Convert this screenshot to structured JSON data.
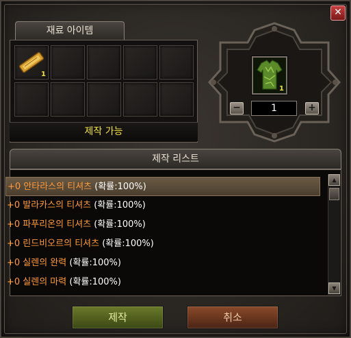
{
  "window": {
    "close_label": "✕"
  },
  "materials": {
    "tab_label": "재료 아이템",
    "slots": [
      {
        "icon": "gold-scroll-icon",
        "count": "1"
      },
      {
        "icon": "",
        "count": ""
      },
      {
        "icon": "",
        "count": ""
      },
      {
        "icon": "",
        "count": ""
      },
      {
        "icon": "",
        "count": ""
      },
      {
        "icon": "",
        "count": ""
      },
      {
        "icon": "",
        "count": ""
      },
      {
        "icon": "",
        "count": ""
      },
      {
        "icon": "",
        "count": ""
      },
      {
        "icon": "",
        "count": ""
      }
    ],
    "status_text": "제작 가능"
  },
  "result": {
    "icon": "green-shirt-icon",
    "count": "1",
    "quantity": "1",
    "minus_label": "−",
    "plus_label": "+"
  },
  "craft_list": {
    "title": "제작 리스트",
    "items": [
      {
        "name": "+0 안타라스의 티셔츠 ",
        "prob": "(확률:100%)",
        "selected": true
      },
      {
        "name": "+0 발라카스의 티셔츠 ",
        "prob": "(확률:100%)",
        "selected": false
      },
      {
        "name": "+0 파푸리온의 티셔츠 ",
        "prob": "(확률:100%)",
        "selected": false
      },
      {
        "name": "+0 린드비오르의 티셔츠 ",
        "prob": "(확률:100%)",
        "selected": false
      },
      {
        "name": "+0 실렌의 완력 ",
        "prob": "(확률:100%)",
        "selected": false
      },
      {
        "name": "+0 실렌의 마력 ",
        "prob": "(확률:100%)",
        "selected": false
      }
    ],
    "scroll_up": "▲",
    "scroll_down": "▼"
  },
  "buttons": {
    "craft_label": "제작",
    "cancel_label": "취소"
  },
  "colors": {
    "item_text": "#ff9a3a",
    "prob_text": "#ffffff",
    "status_text": "#f0e040"
  }
}
